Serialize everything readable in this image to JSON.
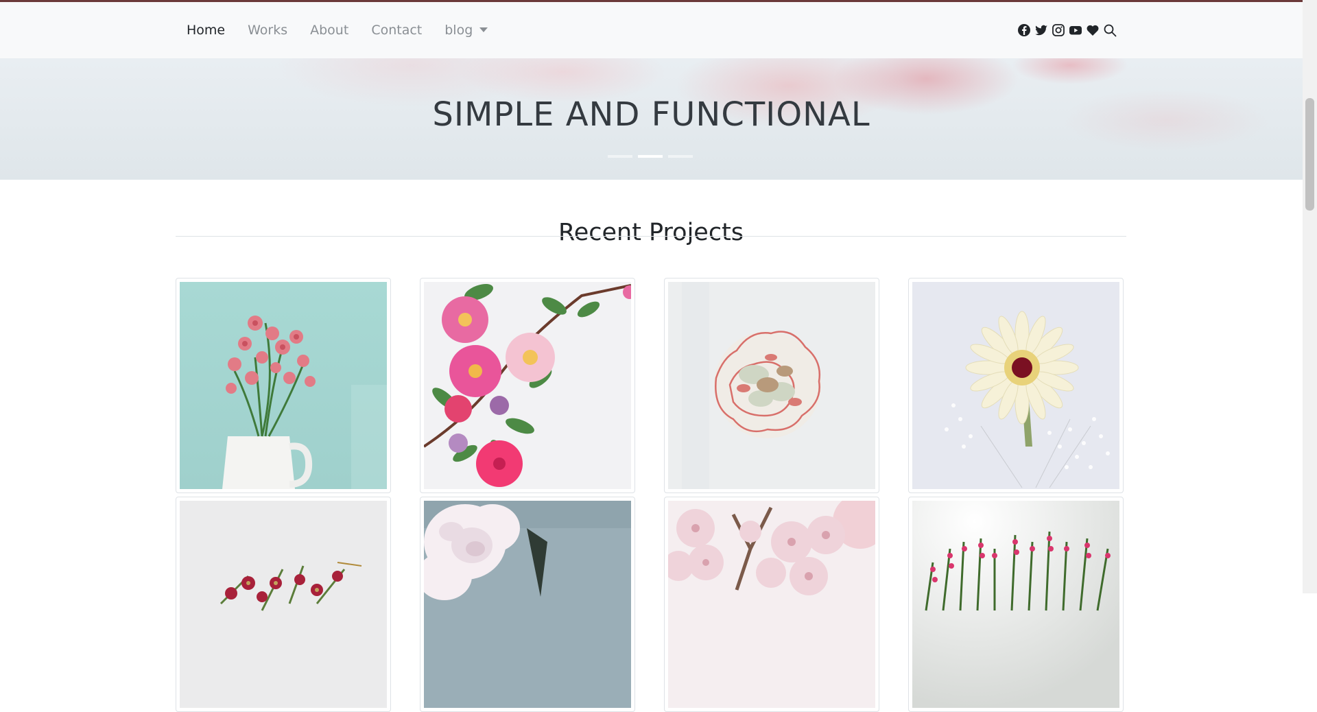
{
  "nav": {
    "links": [
      {
        "label": "Home",
        "active": true
      },
      {
        "label": "Works",
        "active": false
      },
      {
        "label": "About",
        "active": false
      },
      {
        "label": "Contact",
        "active": false
      },
      {
        "label": "blog",
        "active": false,
        "dropdown": true
      }
    ],
    "icons": [
      "facebook-icon",
      "twitter-icon",
      "instagram-icon",
      "youtube-icon",
      "heart-icon",
      "search-icon"
    ]
  },
  "hero": {
    "title": "SIMPLE AND FUNCTIONAL",
    "slides": 3,
    "active_slide": 2
  },
  "projects": {
    "title": "Recent Projects",
    "items": [
      {
        "subject": "pink roses in white pitcher"
      },
      {
        "subject": "pink camellias with leaves"
      },
      {
        "subject": "carnation top view"
      },
      {
        "subject": "white gerbera with gypsophila"
      },
      {
        "subject": "red flowers arrangement"
      },
      {
        "subject": "white peony"
      },
      {
        "subject": "pink cherry blossoms"
      },
      {
        "subject": "pink heather"
      }
    ]
  },
  "colors": {
    "nav_bg": "#f8f9fa",
    "text_dark": "#212529",
    "text_muted": "#8a8f94",
    "accent_line": "#6b3a3a"
  }
}
